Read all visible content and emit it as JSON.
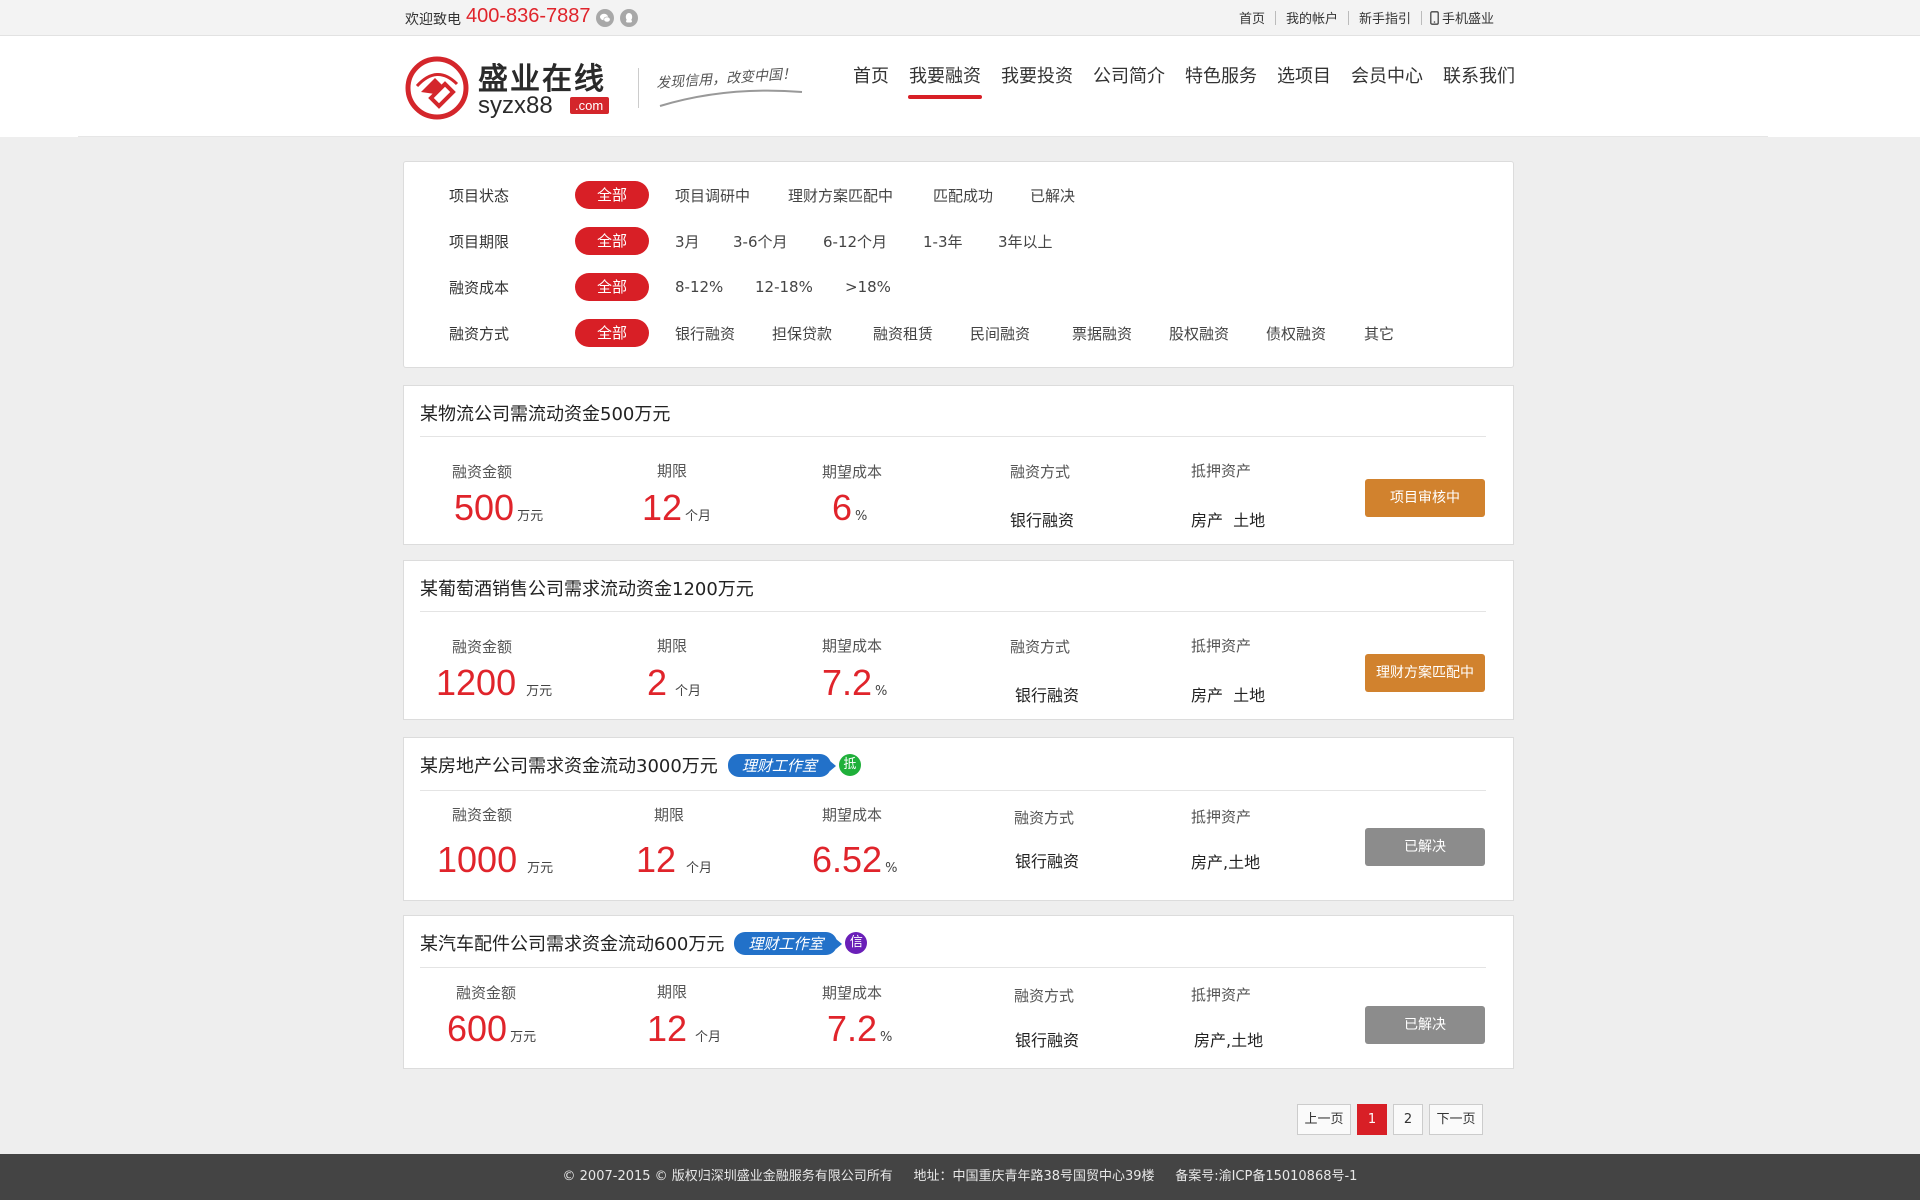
{
  "topbar": {
    "welcome": "欢迎致电",
    "phone": "400-836-7887",
    "links": [
      "首页",
      "我的帐户",
      "新手指引",
      "手机盛业"
    ]
  },
  "header": {
    "logo_name": "盛业在线",
    "logo_domain": "syzx88",
    "logo_dotcom": ".com",
    "slogan": "发现信用，改变中国！",
    "nav": [
      "首页",
      "我要融资",
      "我要投资",
      "公司简介",
      "特色服务",
      "选项目",
      "会员中心",
      "联系我们"
    ],
    "active_nav": "我要融资"
  },
  "filters": [
    {
      "label": "项目状态",
      "options": [
        "全部",
        "项目调研中",
        "理财方案匹配中",
        "匹配成功",
        "已解决"
      ]
    },
    {
      "label": "项目期限",
      "options": [
        "全部",
        "3月",
        "3-6个月",
        "6-12个月",
        "1-3年",
        "3年以上"
      ]
    },
    {
      "label": "融资成本",
      "options": [
        "全部",
        "8-12%",
        "12-18%",
        ">18%"
      ]
    },
    {
      "label": "融资方式",
      "options": [
        "全部",
        "银行融资",
        "担保贷款",
        "融资租赁",
        "民间融资",
        "票据融资",
        "股权融资",
        "债权融资",
        "其它"
      ]
    }
  ],
  "labels": {
    "amount": "融资金额",
    "term": "期限",
    "cost": "期望成本",
    "method": "融资方式",
    "collateral": "抵押资产"
  },
  "units": {
    "amount": "万元",
    "term": "个月",
    "cost": "%"
  },
  "projects": [
    {
      "title": "某物流公司需流动资金500万元",
      "badge": "",
      "tag": "",
      "amount": "500",
      "term": "12",
      "cost": "6",
      "method": "银行融资",
      "collateral": "房产  土地",
      "status": "项目审核中",
      "status_color": "#d1822e"
    },
    {
      "title": "某葡萄酒销售公司需求流动资金1200万元",
      "badge": "",
      "tag": "",
      "amount": "1200",
      "term": "2",
      "cost": "7.2",
      "method": "银行融资",
      "collateral": "房产  土地",
      "status": "理财方案匹配中",
      "status_color": "#d1822e"
    },
    {
      "title": "某房地产公司需求资金流动3000万元",
      "badge": "理财工作室",
      "tag": "抵",
      "tag_color": "#1fb03a",
      "amount": "1000",
      "term": "12",
      "cost": "6.52",
      "method": "银行融资",
      "collateral": "房产,土地",
      "status": "已解决",
      "status_color": "#8c8c8c"
    },
    {
      "title": "某汽车配件公司需求资金流动600万元",
      "badge": "理财工作室",
      "tag": "信",
      "tag_color": "#6a1fb8",
      "amount": "600",
      "term": "12",
      "cost": "7.2",
      "method": "银行融资",
      "collateral": "房产,土地",
      "status": "已解决",
      "status_color": "#8c8c8c"
    }
  ],
  "pagination": {
    "prev": "上一页",
    "pages": [
      "1",
      "2"
    ],
    "current": "1",
    "next": "下一页"
  },
  "footer": {
    "text": "© 2007-2015 © 版权归深圳盛业金融服务有限公司所有     地址：中国重庆青年路38号国贸中心39楼     备案号:渝ICP备15010868号-1"
  },
  "colors": {
    "brand_red": "#d81f26",
    "price_red": "#e0242b",
    "orange": "#d1822e",
    "gray": "#8c8c8c",
    "badge_blue": "#2271c9"
  }
}
